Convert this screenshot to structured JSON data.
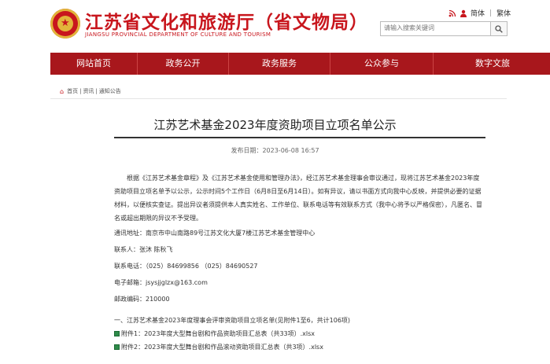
{
  "header": {
    "site_title": "江苏省文化和旅游厅（省文物局）",
    "site_subtitle": "JIANGSU PROVINCIAL DEPARTMENT OF CULTURE AND TOURISM",
    "lang_simplified": "简体",
    "lang_traditional": "繁体",
    "accessibility_separator": "|",
    "search_placeholder": "请输入搜索关键词",
    "icons": {
      "emblem": "national-emblem-icon",
      "rss": "rss-icon",
      "user": "user-icon",
      "search": "search-icon"
    }
  },
  "nav": {
    "items": [
      "网站首页",
      "政务公开",
      "政务服务",
      "公众参与",
      "数字文旅"
    ]
  },
  "breadcrumb": {
    "home": "首页",
    "sep1": "|",
    "l2": "资讯",
    "sep2": "|",
    "l3": "通知公告"
  },
  "article": {
    "title": "江苏艺术基金2023年度资助项目立项名单公示",
    "publish_time": "发布日期：2023-06-08  16:57",
    "paragraph": "根据《江苏艺术基金章程》及《江苏艺术基金使用和管理办法》，经江苏艺术基金理事会审议通过，现将江苏艺术基金2023年度资助项目立项名单予以公示，公示时间5个工作日（6月8日至6月14日）。如有异议，请以书面方式向我中心反映，并提供必要的证据材料，以便核实查证。提出异议者须提供本人真实姓名、工作单位、联系电话等有效联系方式（我中心将予以严格保密），凡匿名、冒名或超出期限的异议不予受理。",
    "contact": {
      "address": "通讯地址：南京市中山南路89号江苏文化大厦7楼江苏艺术基金管理中心",
      "person": "联系人：张沐   陈秋飞",
      "phone": "联系电话：（025）84699856  （025）84690527",
      "email": "电子邮箱：jsysjjglzx@163.com",
      "postcode": "邮政编码：210000"
    },
    "section1": "一、江苏艺术基金2023年度理事会评审资助项目立项名单(见附件1至6，共计106项)",
    "attachments": [
      "附件1：2023年度大型舞台剧和作品资助项目汇总表（共33项）.xlsx",
      "附件2：2023年度大型舞台剧和作品滚动资助项目汇总表（共3项）.xlsx"
    ]
  },
  "colors": {
    "brand_red": "#c8161d",
    "nav_red": "#a8171c"
  }
}
